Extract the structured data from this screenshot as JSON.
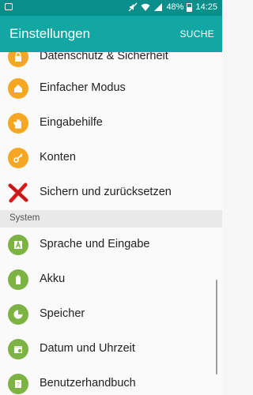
{
  "status_bar": {
    "battery_percent": "48%",
    "time": "14:25",
    "icons": [
      "screenshot-icon",
      "mute-icon",
      "wifi-icon",
      "signal-icon",
      "battery-icon"
    ]
  },
  "app_bar": {
    "title": "Einstellungen",
    "search_label": "SUCHE"
  },
  "colors": {
    "status_bar": "#0a8e8c",
    "app_bar": "#13a7a3",
    "orange_icon": "#f5a623",
    "green_icon": "#7cb342"
  },
  "items_top": [
    {
      "label": "Datenschutz & Sicherheit",
      "icon": "lock-icon"
    },
    {
      "label": "Einfacher Modus",
      "icon": "home-icon"
    },
    {
      "label": "Eingabehilfe",
      "icon": "hand-icon"
    },
    {
      "label": "Konten",
      "icon": "key-icon"
    },
    {
      "label": "Sichern und zurücksetzen",
      "icon": "red-x-icon"
    }
  ],
  "section_header": "System",
  "items_system": [
    {
      "label": "Sprache und Eingabe",
      "icon": "language-icon"
    },
    {
      "label": "Akku",
      "icon": "battery-icon"
    },
    {
      "label": "Speicher",
      "icon": "storage-icon"
    },
    {
      "label": "Datum und Uhrzeit",
      "icon": "calendar-icon"
    },
    {
      "label": "Benutzerhandbuch",
      "icon": "manual-icon"
    }
  ]
}
